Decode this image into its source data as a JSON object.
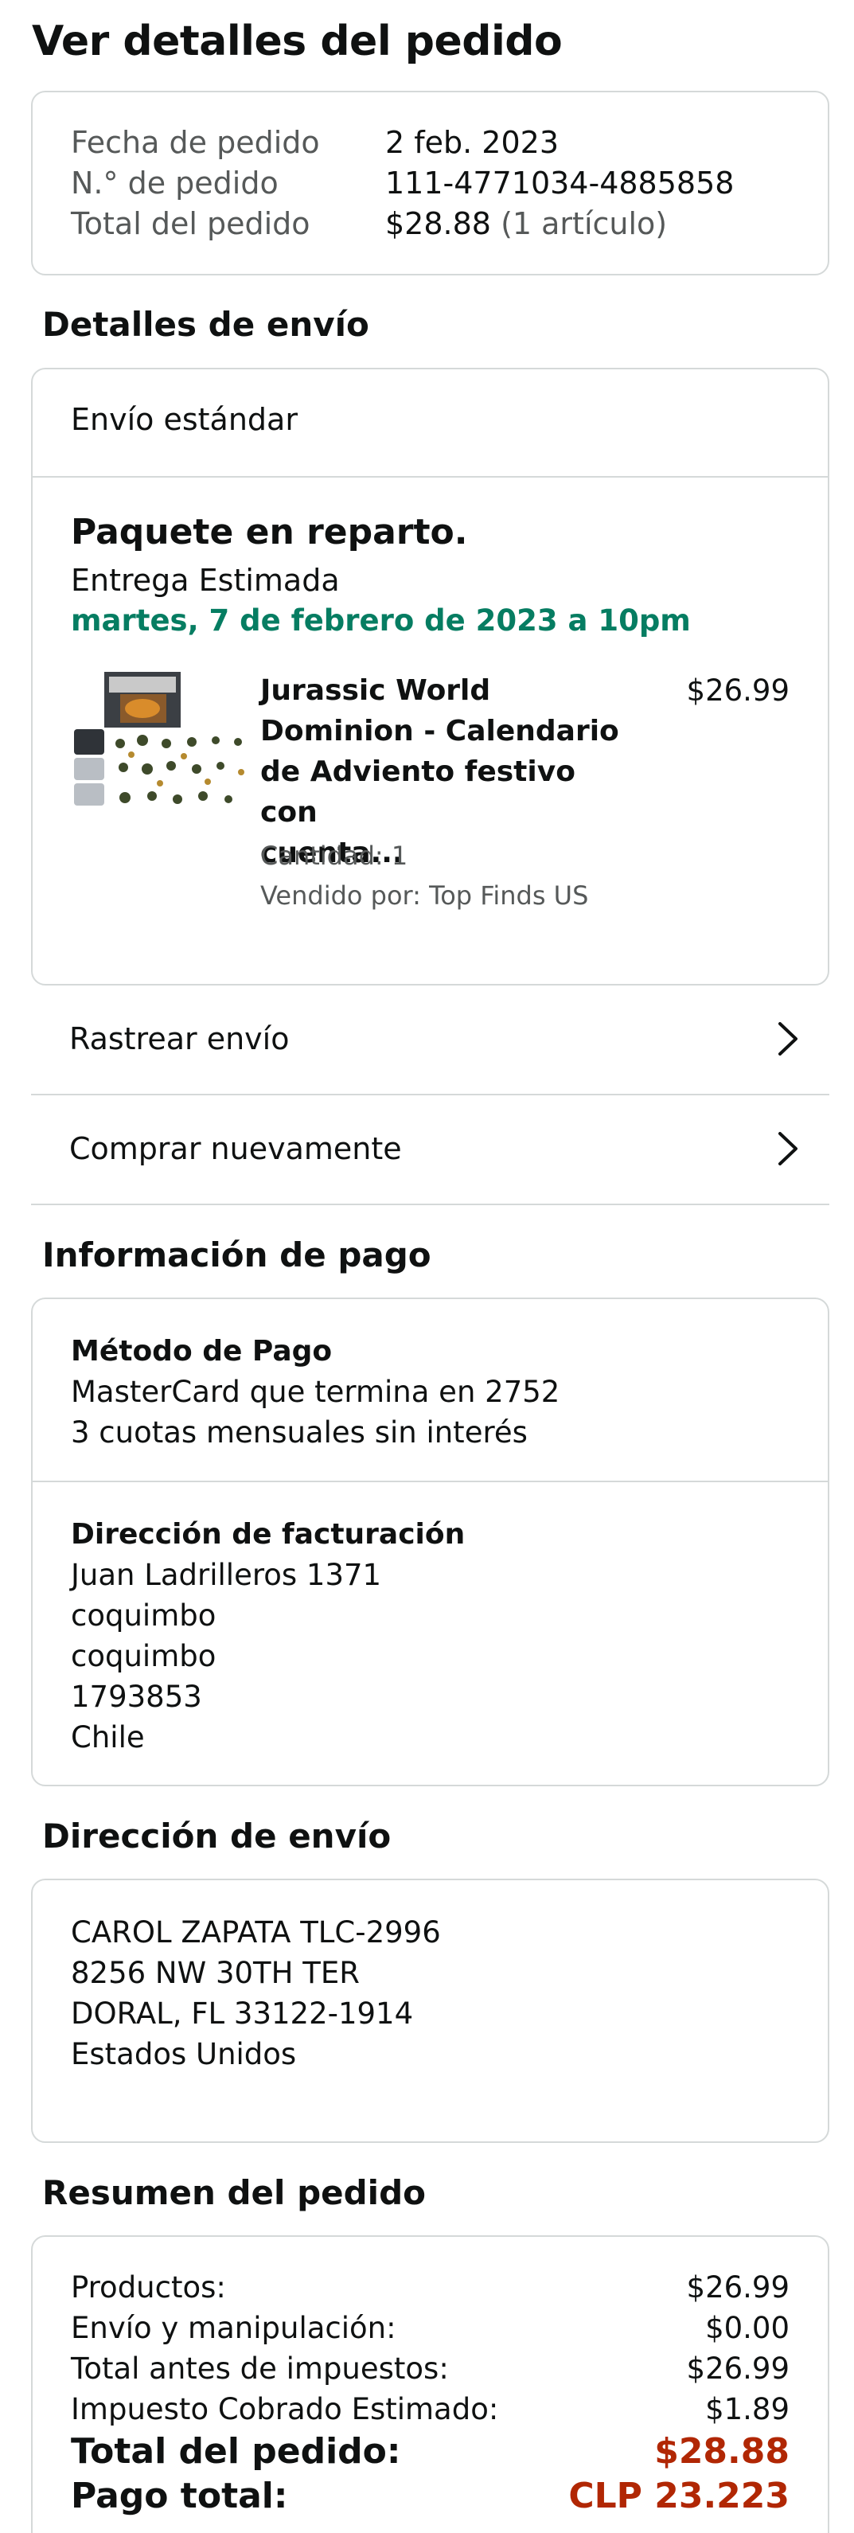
{
  "page": {
    "title": "Ver detalles del pedido"
  },
  "order_info": {
    "date_label": "Fecha de pedido",
    "date_value": "2 feb. 2023",
    "number_label": "N.° de pedido",
    "number_value": "111-4771034-4885858",
    "total_label": "Total del pedido",
    "total_value": "$28.88",
    "total_items": "(1 artículo)"
  },
  "shipping_details": {
    "title": "Detalles de envío",
    "method": "Envío estándar",
    "status": "Paquete en reparto.",
    "estimated_label": "Entrega Estimada",
    "estimated_date": "martes, 7 de febrero de 2023 a 10pm",
    "item": {
      "name": "Jurassic World Dominion - Calendario de Adviento festivo con cuenta...",
      "name_lines": [
        "Jurassic World",
        "Dominion - Calendario",
        "de Adviento festivo con",
        "cuenta..."
      ],
      "price": "$26.99",
      "quantity": "Cantidad: 1",
      "sold_by": "Vendido por: Top Finds US"
    }
  },
  "actions": {
    "track": "Rastrear envío",
    "buy_again": "Comprar nuevamente"
  },
  "payment": {
    "title": "Información de pago",
    "method_title": "Método de Pago",
    "method_line1": "MasterCard que termina en 2752",
    "method_line2": "3 cuotas mensuales sin interés",
    "billing_title": "Dirección de facturación",
    "billing_lines": [
      "Juan Ladrilleros 1371",
      "coquimbo",
      "coquimbo",
      "1793853",
      "Chile"
    ]
  },
  "shipping_address": {
    "title": "Dirección de envío",
    "lines": [
      "CAROL ZAPATA TLC-2996",
      "8256 NW 30TH TER",
      "DORAL, FL 33122-1914",
      "Estados Unidos"
    ]
  },
  "summary": {
    "title": "Resumen del pedido",
    "rows": [
      {
        "label": "Productos:",
        "value": "$26.99"
      },
      {
        "label": "Envío y manipulación:",
        "value": "$0.00"
      },
      {
        "label": "Total antes de impuestos:",
        "value": "$26.99"
      },
      {
        "label": "Impuesto Cobrado Estimado:",
        "value": "$1.89"
      }
    ],
    "order_total_label": "Total del pedido:",
    "order_total_value": "$28.88",
    "payment_total_label": "Pago total:",
    "payment_total_value": "CLP 23.223"
  },
  "icons": {
    "chevron": "chevron-right-icon",
    "product": "product-thumbnail"
  },
  "colors": {
    "green": "#067d62",
    "red": "#b12704",
    "border": "#d5d9d9",
    "muted": "#565959"
  }
}
